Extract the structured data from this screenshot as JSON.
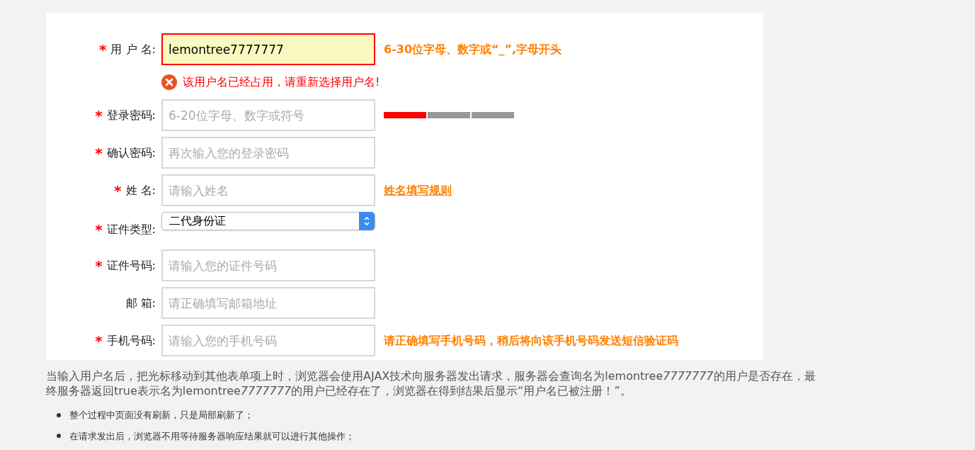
{
  "form": {
    "rows": [
      {
        "required_mark": "*",
        "label": "用 户 名:",
        "kind": "input",
        "value": "lemontree7777777",
        "error": true,
        "hint": {
          "kind": "note",
          "text": "6-30位字母、数字或“_”,字母开头"
        },
        "message": "该用户名已经占用，请重新选择用户名!"
      },
      {
        "required_mark": "*",
        "label": "登录密码:",
        "kind": "input",
        "placeholder": "6-20位字母、数字或符号",
        "error": false,
        "hint": {
          "kind": "strength",
          "level": 0.33
        }
      },
      {
        "required_mark": "*",
        "label": "确认密码:",
        "kind": "input",
        "placeholder": "再次输入您的登录密码",
        "error": false
      },
      {
        "required_mark": "*",
        "label": "姓 名:",
        "kind": "input",
        "placeholder": "请输入姓名",
        "error": false,
        "hint": {
          "kind": "link",
          "text": "姓名填写规则"
        }
      },
      {
        "required_mark": "*",
        "label": "证件类型:",
        "kind": "select",
        "value": "二代身份证"
      },
      {
        "required_mark": "*",
        "label": "证件号码:",
        "kind": "input",
        "placeholder": "请输入您的证件号码",
        "error": false
      },
      {
        "label": "邮 箱:",
        "kind": "input",
        "placeholder": "请正确填写邮箱地址",
        "error": false
      },
      {
        "required_mark": "*",
        "label": "手机号码:",
        "kind": "input",
        "placeholder": "请输入您的手机号码",
        "error": false,
        "hint": {
          "kind": "note",
          "text": "请正确填写手机号码，稍后将向该手机号码发送短信验证码"
        }
      }
    ]
  },
  "explanation": [
    {
      "text": "当输入用户名后，把光标移动到其他表单项上时，浏览器会使用AJAX技术向服务器发出请求，服务器会查询名为lemontree",
      "italic": false
    },
    {
      "text": "7777777",
      "italic": true
    },
    {
      "text": "的用户是否存在，最终服务器返回true表示名为lemontree",
      "italic": false
    },
    {
      "text": "7777777",
      "italic": true
    },
    {
      "text": "的用户已经存在了，浏览器在得到结果后显示“用户名已被注册！”。",
      "italic": false
    }
  ],
  "bullets": [
    "整个过程中页面没有刷新，只是局部刷新了；",
    "在请求发出后，浏览器不用等待服务器响应结果就可以进行其他操作；"
  ]
}
